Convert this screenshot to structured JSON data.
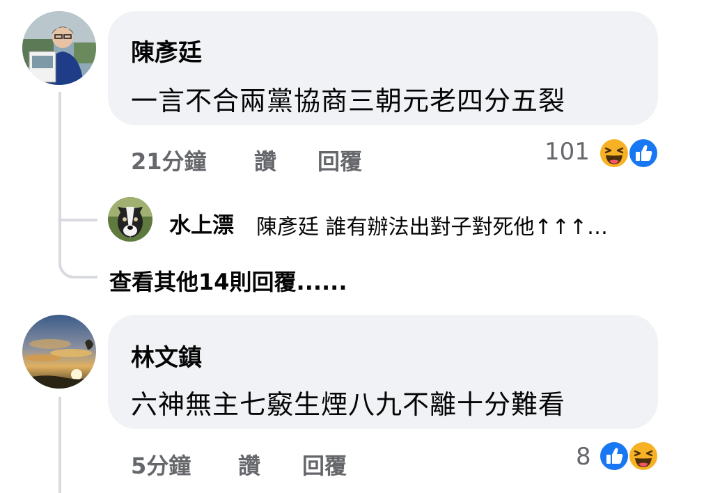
{
  "comments": [
    {
      "author": "陳彥廷",
      "text": "一言不合兩黨協商三朝元老四分五裂",
      "time": "21分鐘",
      "like_label": "讚",
      "reply_label": "回覆",
      "reaction_count": "101",
      "reactions": [
        "haha-icon",
        "like-icon"
      ]
    },
    {
      "author": "林文鎮",
      "text": "六神無主七竅生煙八九不離十分難看",
      "time": "5分鐘",
      "like_label": "讚",
      "reply_label": "回覆",
      "reaction_count": "8",
      "reactions": [
        "like-icon",
        "haha-icon"
      ]
    }
  ],
  "reply_preview": {
    "author": "水上漂",
    "text": "陳彥廷 誰有辦法出對子對死他↑↑↑…"
  },
  "more_replies_label": "查看其他14則回覆......",
  "colors": {
    "bubble": "#f0f2f5",
    "meta": "#65676b",
    "like_blue": "#1877f2",
    "haha_yellow": "#f7b125"
  }
}
